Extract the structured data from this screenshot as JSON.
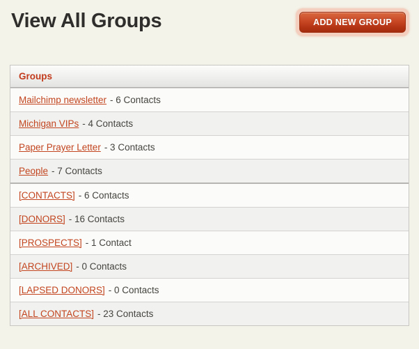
{
  "page": {
    "title": "View All Groups"
  },
  "toolbar": {
    "add_button_label": "ADD NEW GROUP"
  },
  "table": {
    "header": "Groups",
    "rows": [
      {
        "name": "Mailchimp newsletter",
        "count_text": "- 6 Contacts"
      },
      {
        "name": "Michigan VIPs",
        "count_text": "- 4 Contacts"
      },
      {
        "name": "Paper Prayer Letter",
        "count_text": "- 3 Contacts"
      },
      {
        "name": "People",
        "count_text": "- 7 Contacts"
      },
      {
        "name": "[CONTACTS]",
        "count_text": "- 6 Contacts"
      },
      {
        "name": "[DONORS]",
        "count_text": "- 16 Contacts"
      },
      {
        "name": "[PROSPECTS]",
        "count_text": "- 1 Contact"
      },
      {
        "name": "[ARCHIVED]",
        "count_text": "- 0 Contacts"
      },
      {
        "name": "[LAPSED DONORS]",
        "count_text": "- 0 Contacts"
      },
      {
        "name": "[ALL CONTACTS]",
        "count_text": "- 23 Contacts"
      }
    ]
  },
  "colors": {
    "page_background": "#f4f3e9",
    "accent_red": "#c2451f",
    "button_gradient_top": "#d96940",
    "button_gradient_bottom": "#a42c0e",
    "button_halo": "#f4cebe",
    "title_text": "#2f2e2c",
    "count_text": "#454440",
    "row_stripe_gray": "#f1f1ef",
    "row_stripe_white": "#fbfbf9"
  }
}
